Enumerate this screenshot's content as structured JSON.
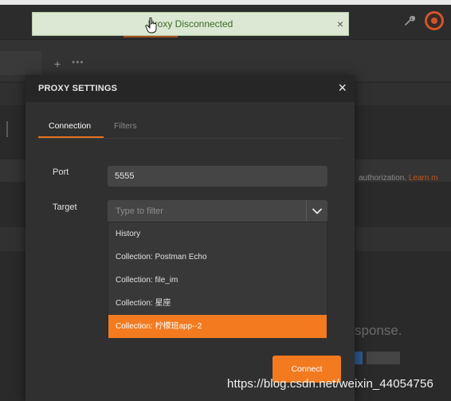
{
  "toast": {
    "message": "Proxy Disconnected",
    "close_glyph": "×"
  },
  "background": {
    "plus": "+",
    "dots": "•••",
    "auth_text_prefix": "authorization.",
    "auth_link": "Learn m",
    "response_text": "sponse."
  },
  "modal": {
    "title": "PROXY SETTINGS",
    "close_glyph": "×",
    "tabs": [
      {
        "label": "Connection",
        "active": true
      },
      {
        "label": "Filters",
        "active": false
      }
    ],
    "port": {
      "label": "Port",
      "value": "5555"
    },
    "target": {
      "label": "Target",
      "placeholder": "Type to filter",
      "options": [
        {
          "label": "History",
          "selected": false
        },
        {
          "label": "Collection: Postman Echo",
          "selected": false
        },
        {
          "label": "Collection: file_im",
          "selected": false
        },
        {
          "label": "Collection: 星座",
          "selected": false
        },
        {
          "label": "Collection: 柠檬班app--2",
          "selected": true
        }
      ]
    },
    "connect_label": "Connect"
  },
  "watermark": "https://blog.csdn.net/weixin_44054756",
  "colors": {
    "accent": "#f37a1f",
    "toast_bg": "#dbe8d3",
    "toast_text": "#3d6a2b",
    "modal_bg": "#303030",
    "input_bg": "#454545"
  }
}
